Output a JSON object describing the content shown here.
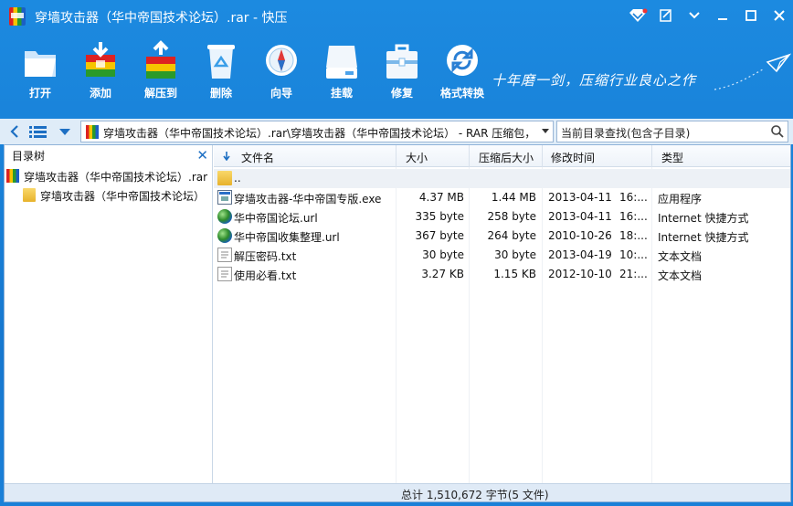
{
  "window": {
    "title": "穿墙攻击器（华中帝国技术论坛）.rar - 快压"
  },
  "toolbar": {
    "items": [
      {
        "label": "打开",
        "icon": "open-folder-icon"
      },
      {
        "label": "添加",
        "icon": "add-archive-icon"
      },
      {
        "label": "解压到",
        "icon": "extract-archive-icon"
      },
      {
        "label": "删除",
        "icon": "recycle-bin-icon"
      },
      {
        "label": "向导",
        "icon": "compass-icon"
      },
      {
        "label": "挂载",
        "icon": "drive-icon"
      },
      {
        "label": "修复",
        "icon": "toolbox-icon"
      },
      {
        "label": "格式转换",
        "icon": "convert-icon"
      }
    ],
    "slogan": "十年磨一剑，压缩行业良心之作"
  },
  "address": {
    "path": "穿墙攻击器（华中帝国技术论坛）.rar\\穿墙攻击器（华中帝国技术论坛） - RAR 压缩包，大",
    "search_placeholder": "当前目录查找(包含子目录)"
  },
  "tree": {
    "title": "目录树",
    "items": [
      {
        "label": "穿墙攻击器（华中帝国技术论坛）.rar",
        "icon": "rar-archive-icon"
      },
      {
        "label": "穿墙攻击器（华中帝国技术论坛）",
        "icon": "folder-icon"
      }
    ]
  },
  "columns": [
    "文件名",
    "大小",
    "压缩后大小",
    "修改时间",
    "类型"
  ],
  "files": [
    {
      "name": "..",
      "icon": "folder-icon",
      "size": "",
      "packed": "",
      "date": "",
      "time": "",
      "type": ""
    },
    {
      "name": "穿墙攻击器-华中帝国专版.exe",
      "icon": "exe-icon",
      "size": "4.37 MB",
      "packed": "1.44 MB",
      "date": "2013-04-11",
      "time": "16:...",
      "type": "应用程序"
    },
    {
      "name": "华中帝国论坛.url",
      "icon": "globe-icon",
      "size": "335 byte",
      "packed": "258 byte",
      "date": "2013-04-11",
      "time": "16:...",
      "type": "Internet 快捷方式"
    },
    {
      "name": "华中帝国收集整理.url",
      "icon": "globe-icon",
      "size": "367 byte",
      "packed": "264 byte",
      "date": "2010-10-26",
      "time": "18:...",
      "type": "Internet 快捷方式"
    },
    {
      "name": "解压密码.txt",
      "icon": "text-file-icon",
      "size": "30 byte",
      "packed": "30 byte",
      "date": "2013-04-19",
      "time": "10:...",
      "type": "文本文档"
    },
    {
      "name": "使用必看.txt",
      "icon": "text-file-icon",
      "size": "3.27 KB",
      "packed": "1.15 KB",
      "date": "2012-10-10",
      "time": "21:...",
      "type": "文本文档"
    }
  ],
  "status": {
    "text": "总计  1,510,672 字节(5 文件)"
  }
}
